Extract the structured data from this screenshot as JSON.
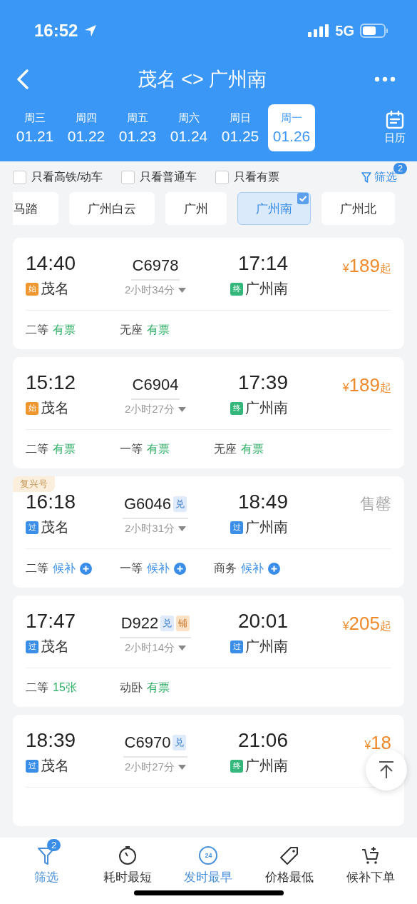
{
  "status_bar": {
    "time": "16:52",
    "network": "5G"
  },
  "header": {
    "title": "茂名 <> 广州南",
    "calendar_label": "日历"
  },
  "dates": [
    {
      "weekday": "周三",
      "date": "01.21",
      "selected": false
    },
    {
      "weekday": "周四",
      "date": "01.22",
      "selected": false
    },
    {
      "weekday": "周五",
      "date": "01.23",
      "selected": false
    },
    {
      "weekday": "周六",
      "date": "01.24",
      "selected": false
    },
    {
      "weekday": "周日",
      "date": "01.25",
      "selected": false
    },
    {
      "weekday": "周一",
      "date": "01.26",
      "selected": true
    }
  ],
  "filters": [
    {
      "label": "只看高铁/动车",
      "checked": false
    },
    {
      "label": "只看普通车",
      "checked": false
    },
    {
      "label": "只看有票",
      "checked": false
    }
  ],
  "filter_button": {
    "label": "筛选",
    "badge": "2"
  },
  "stations": [
    {
      "label": "马踏",
      "selected": false
    },
    {
      "label": "广州白云",
      "selected": false
    },
    {
      "label": "广州",
      "selected": false
    },
    {
      "label": "广州南",
      "selected": true
    },
    {
      "label": "广州北",
      "selected": false
    }
  ],
  "trains": [
    {
      "depart": "14:40",
      "from": {
        "tag": "始",
        "kind": "start",
        "name": "茂名"
      },
      "number": "C6978",
      "duration": "2小时34分",
      "arrive": "17:14",
      "to": {
        "tag": "终",
        "kind": "end",
        "name": "广州南"
      },
      "price": {
        "kind": "price",
        "currency": "¥",
        "amount": "189",
        "suffix": "起"
      },
      "seats": [
        {
          "class": "二等",
          "status": "有票",
          "kind": "available"
        },
        {
          "class": "无座",
          "status": "有票",
          "kind": "available"
        }
      ]
    },
    {
      "depart": "15:12",
      "from": {
        "tag": "始",
        "kind": "start",
        "name": "茂名"
      },
      "number": "C6904",
      "duration": "2小时27分",
      "arrive": "17:39",
      "to": {
        "tag": "终",
        "kind": "end",
        "name": "广州南"
      },
      "price": {
        "kind": "price",
        "currency": "¥",
        "amount": "189",
        "suffix": "起"
      },
      "seats": [
        {
          "class": "二等",
          "status": "有票",
          "kind": "available"
        },
        {
          "class": "一等",
          "status": "有票",
          "kind": "available"
        },
        {
          "class": "无座",
          "status": "有票",
          "kind": "available"
        }
      ]
    },
    {
      "label": "复兴号",
      "depart": "16:18",
      "from": {
        "tag": "过",
        "kind": "pass",
        "name": "茂名"
      },
      "number": "G6046",
      "badges": [
        {
          "text": "兑",
          "kind": "exchange"
        }
      ],
      "duration": "2小时31分",
      "arrive": "18:49",
      "to": {
        "tag": "过",
        "kind": "pass",
        "name": "广州南"
      },
      "price": {
        "kind": "sold_out",
        "text": "售罄"
      },
      "seats": [
        {
          "class": "二等",
          "status": "候补",
          "kind": "waitlist"
        },
        {
          "class": "一等",
          "status": "候补",
          "kind": "waitlist"
        },
        {
          "class": "商务",
          "status": "候补",
          "kind": "waitlist"
        }
      ]
    },
    {
      "depart": "17:47",
      "from": {
        "tag": "过",
        "kind": "pass",
        "name": "茂名"
      },
      "number": "D922",
      "badges": [
        {
          "text": "兑",
          "kind": "exchange"
        },
        {
          "text": "铺",
          "kind": "berth"
        }
      ],
      "duration": "2小时14分",
      "arrive": "20:01",
      "to": {
        "tag": "过",
        "kind": "pass",
        "name": "广州南"
      },
      "price": {
        "kind": "price",
        "currency": "¥",
        "amount": "205",
        "suffix": "起"
      },
      "seats": [
        {
          "class": "二等",
          "status": "15张",
          "kind": "available"
        },
        {
          "class": "动卧",
          "status": "有票",
          "kind": "available"
        }
      ]
    },
    {
      "depart": "18:39",
      "from": {
        "tag": "过",
        "kind": "pass",
        "name": "茂名"
      },
      "number": "C6970",
      "badges": [
        {
          "text": "兑",
          "kind": "exchange"
        }
      ],
      "duration": "2小时27分",
      "arrive": "21:06",
      "to": {
        "tag": "终",
        "kind": "end",
        "name": "广州南"
      },
      "price": {
        "kind": "price",
        "currency": "¥",
        "amount": "18"
      }
    }
  ],
  "bottom_tabs": [
    {
      "label": "筛选",
      "kind": "filter",
      "badge": "2",
      "selected": true
    },
    {
      "label": "耗时最短",
      "kind": "duration",
      "selected": false
    },
    {
      "label": "发时最早",
      "kind": "departure",
      "icon_text": "24",
      "selected": true
    },
    {
      "label": "价格最低",
      "kind": "price",
      "selected": false
    },
    {
      "label": "候补下单",
      "kind": "waitlist",
      "selected": false
    }
  ]
}
